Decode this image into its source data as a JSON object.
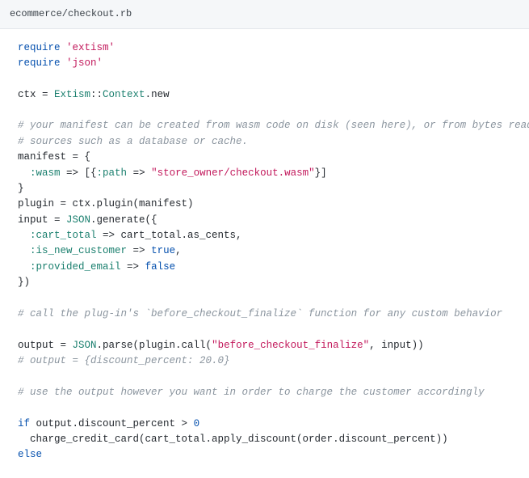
{
  "header": {
    "path": "ecommerce/checkout.rb"
  },
  "code": {
    "l01_kw": "require",
    "l01_str": "'extism'",
    "l02_kw": "require",
    "l02_str": "'json'",
    "l04a": "ctx = ",
    "l04_const1": "Extism",
    "l04_sep": "::",
    "l04_const2": "Context",
    "l04b": ".new",
    "l06_cmt": "# your manifest can be created from wasm code on disk (seen here), or from bytes read from other",
    "l07_cmt": "# sources such as a database or cache.",
    "l08": "manifest = {",
    "l09_indent": "  ",
    "l09_sym": ":wasm",
    "l09_arrow": " => [{",
    "l09_sym2": ":path",
    "l09_arrow2": " => ",
    "l09_str": "\"store_owner/checkout.wasm\"",
    "l09_end": "}]",
    "l10": "}",
    "l11": "plugin = ctx.plugin(manifest)",
    "l12a": "input = ",
    "l12_const": "JSON",
    "l12b": ".generate({",
    "l13_indent": "  ",
    "l13_sym": ":cart_total",
    "l13_rest": " => cart_total.as_cents,",
    "l14_indent": "  ",
    "l14_sym": ":is_new_customer",
    "l14_arrow": " => ",
    "l14_true": "true",
    "l14_comma": ",",
    "l15_indent": "  ",
    "l15_sym": ":provided_email",
    "l15_arrow": " => ",
    "l15_false": "false",
    "l16": "})",
    "l18_cmt": "# call the plug-in's `before_checkout_finalize` function for any custom behavior",
    "l20a": "output = ",
    "l20_const": "JSON",
    "l20b": ".parse(plugin.call(",
    "l20_str": "\"before_checkout_finalize\"",
    "l20c": ", input))",
    "l21_cmt": "# output = {discount_percent: 20.0}",
    "l23_cmt": "# use the output however you want in order to charge the customer accordingly",
    "l25_if": "if",
    "l25_rest": " output.discount_percent > ",
    "l25_num": "0",
    "l26": "  charge_credit_card(cart_total.apply_discount(order.discount_percent))",
    "l27_else": "else"
  }
}
